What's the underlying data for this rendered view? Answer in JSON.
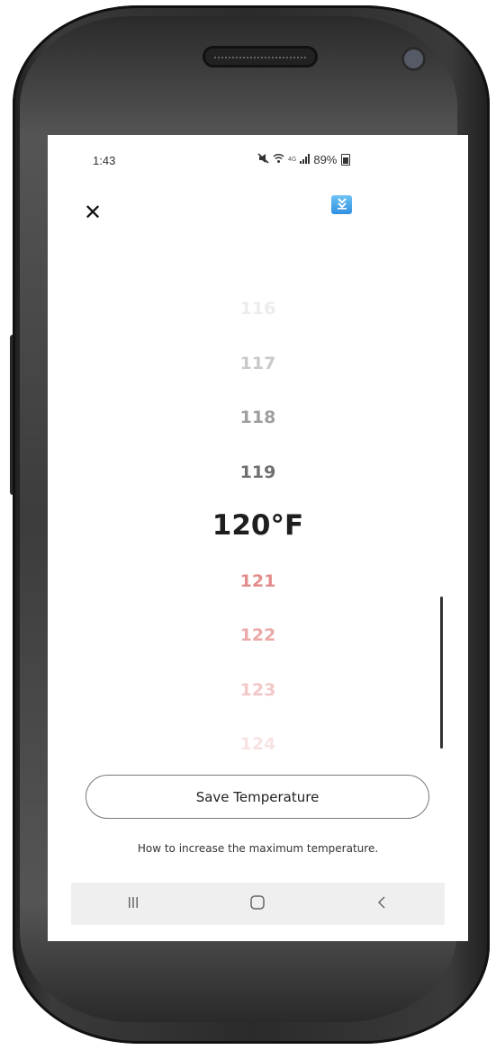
{
  "status_bar": {
    "time": "1:43",
    "network_label": "4G",
    "battery": "89%"
  },
  "picker": {
    "unit": "°F",
    "selected_value": 120,
    "selected_label": "120°F",
    "options": [
      {
        "label": "116",
        "color": "#ececec"
      },
      {
        "label": "117",
        "color": "#c9c9c9"
      },
      {
        "label": "118",
        "color": "#9e9e9e"
      },
      {
        "label": "119",
        "color": "#6f6f6f"
      },
      {
        "label": "120°F",
        "color": "#1e1e1e",
        "selected": true
      },
      {
        "label": "121",
        "color": "#e38c8c"
      },
      {
        "label": "122",
        "color": "#eba9a9"
      },
      {
        "label": "123",
        "color": "#f2c7c7"
      },
      {
        "label": "124",
        "color": "#f8e3e3"
      }
    ]
  },
  "actions": {
    "save_label": "Save Temperature",
    "help_link": "How to increase the maximum temperature."
  },
  "icons": {
    "close": "close-icon",
    "collapse": "double-chevron-down-icon",
    "nav_recent": "recent-apps-icon",
    "nav_home": "home-icon",
    "nav_back": "back-icon"
  },
  "colors": {
    "accent_cold": "#6f6f6f",
    "accent_hot": "#e38c8c",
    "collapse_button": "#2f8fe0"
  }
}
